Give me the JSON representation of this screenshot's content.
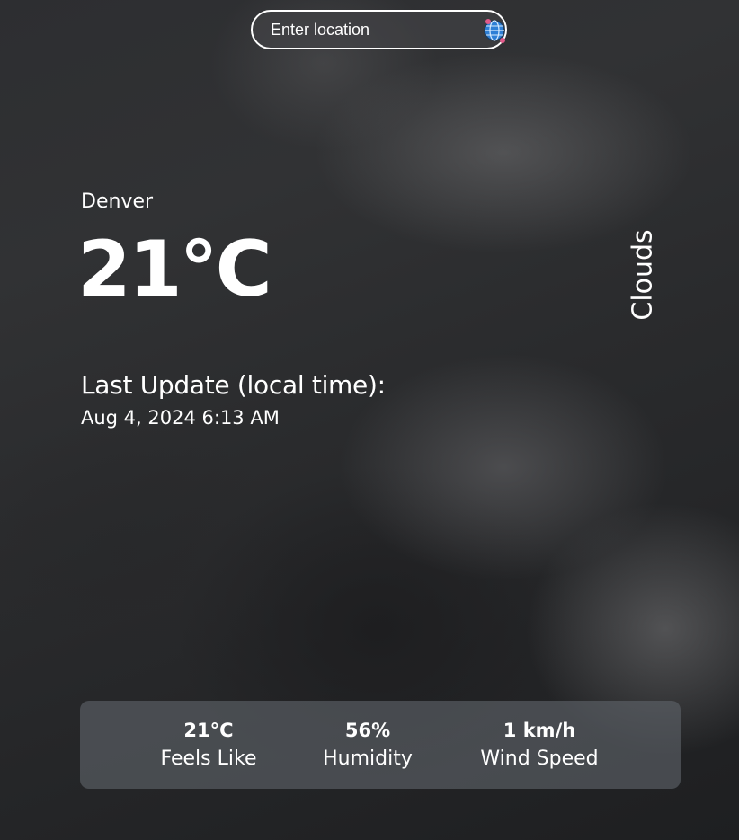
{
  "search": {
    "placeholder": "Enter location",
    "value": "",
    "button_icon": "globe-location-icon"
  },
  "weather": {
    "city": "Denver",
    "temperature": "21°C",
    "condition": "Clouds",
    "last_update_label": "Last Update (local time):",
    "last_update_time": "Aug 4, 2024 6:13 AM"
  },
  "stats": [
    {
      "value": "21°C",
      "label": "Feels Like"
    },
    {
      "value": "56%",
      "label": "Humidity"
    },
    {
      "value": "1 km/h",
      "label": "Wind Speed"
    }
  ],
  "colors": {
    "text": "#ffffff",
    "panel": "#5f646a",
    "globe": "#2e7fd6",
    "pin": "#e05a8a"
  }
}
